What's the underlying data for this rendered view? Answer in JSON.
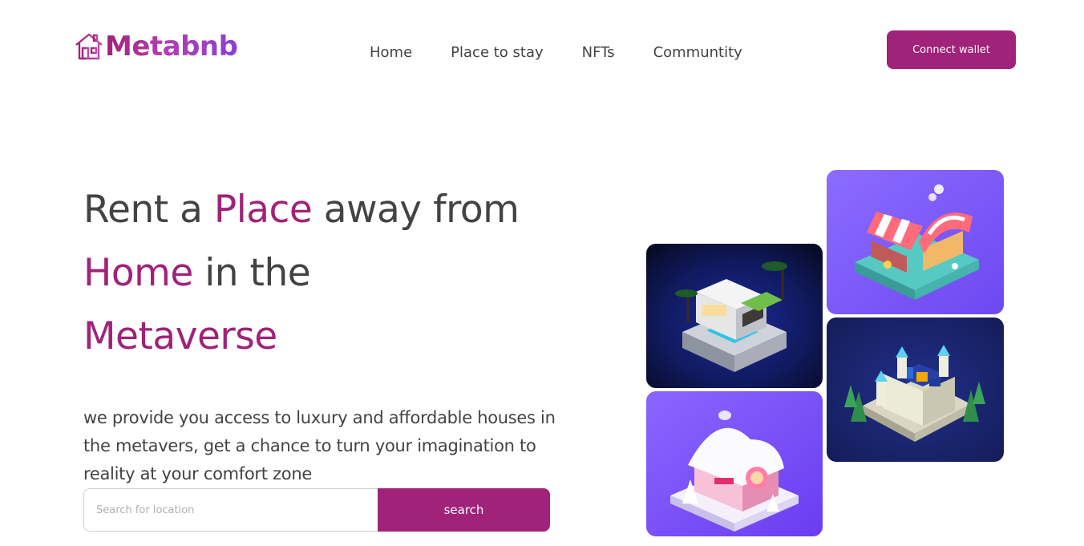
{
  "header": {
    "logo_text": "Metabnb",
    "logo_icon": "house-icon",
    "nav": [
      "Home",
      "Place to stay",
      "NFTs",
      "Communtity"
    ],
    "connect_label": "Connect wallet"
  },
  "hero": {
    "title_parts": [
      "Rent a ",
      "Place",
      " away from ",
      "Home",
      " in the ",
      "Metaverse"
    ],
    "description": "we provide you access to luxury and affordable houses in the metavers, get a chance to turn your imagination to reality at your comfort zone",
    "search_placeholder": "Search for location",
    "search_label": "search"
  },
  "gallery": {
    "images": [
      "modern-villa-image",
      "snow-cottage-image",
      "market-stall-image",
      "castle-image"
    ]
  },
  "colors": {
    "accent": "#a02279",
    "text": "#434343",
    "logo_gradient_end": "#8a3fd8"
  }
}
